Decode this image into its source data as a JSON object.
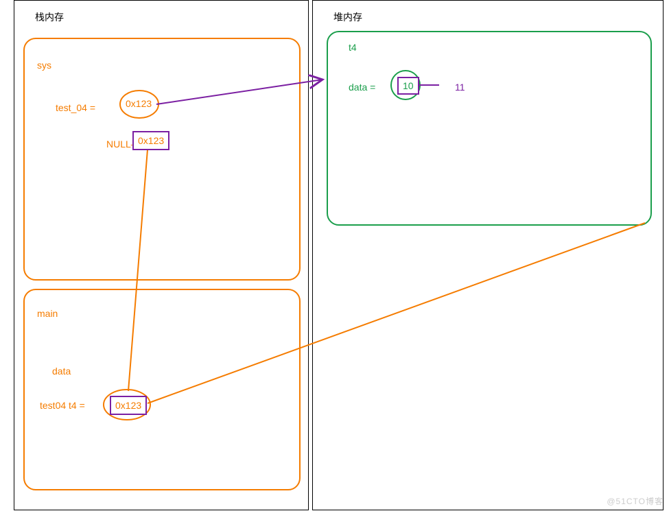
{
  "stack": {
    "title": "栈内存",
    "sys": {
      "label": "sys",
      "var_label": "test_04  =",
      "var_addr": "0x123",
      "null_label": "NULL—>",
      "null_addr": "0x123"
    },
    "main": {
      "label": "main",
      "data_label": "data",
      "var_label": "test04  t4   =",
      "var_addr": "0x123"
    }
  },
  "heap": {
    "title": "堆内存",
    "t4": {
      "label": "t4",
      "data_label": "data   =",
      "value": "10",
      "new_value": "11"
    }
  },
  "watermark": "@51CTO博客",
  "colors": {
    "orange": "#f57c00",
    "green": "#1a9e4b",
    "purple": "#7b1fa2"
  }
}
